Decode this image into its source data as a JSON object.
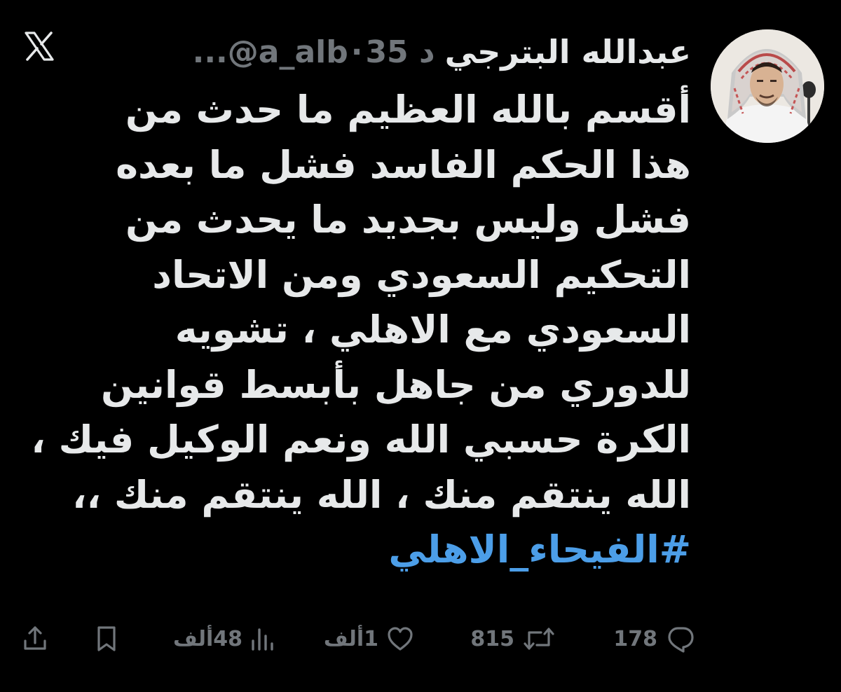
{
  "app": {
    "logo_icon": "x-logo-icon"
  },
  "author": {
    "display_name": "عبدالله البترجي",
    "handle": "...@a_alb",
    "separator": "·",
    "time_ago": "35 د",
    "avatar_icon": "avatar"
  },
  "tweet": {
    "lines": [
      "أقسم بالله العظيم ما حدث من",
      "هذا الحكم الفاسد فشل ما بعده",
      "فشل وليس بجديد ما يحدث من",
      "التحكيم السعودي ومن الاتحاد",
      "السعودي مع الاهلي ، تشويه",
      "للدوري من جاهل بأبسط قوانين",
      "الكرة حسبي الله ونعم الوكيل فيك ،",
      "الله ينتقم منك ، الله ينتقم منك ،،"
    ],
    "hashtag": "#الفيحاء_الاهلي"
  },
  "actions": {
    "reply": {
      "count": "178",
      "icon": "reply-icon"
    },
    "retweet": {
      "count": "815",
      "icon": "retweet-icon"
    },
    "like": {
      "count": "1ألف",
      "icon": "heart-icon"
    },
    "views": {
      "count": "48ألف",
      "icon": "views-chart-icon"
    },
    "bookmark": {
      "icon": "bookmark-icon"
    },
    "share": {
      "icon": "share-icon"
    }
  },
  "colors": {
    "background": "#000000",
    "text_primary": "#e7e9ea",
    "text_secondary": "#71767b",
    "link": "#4c9ee8"
  }
}
